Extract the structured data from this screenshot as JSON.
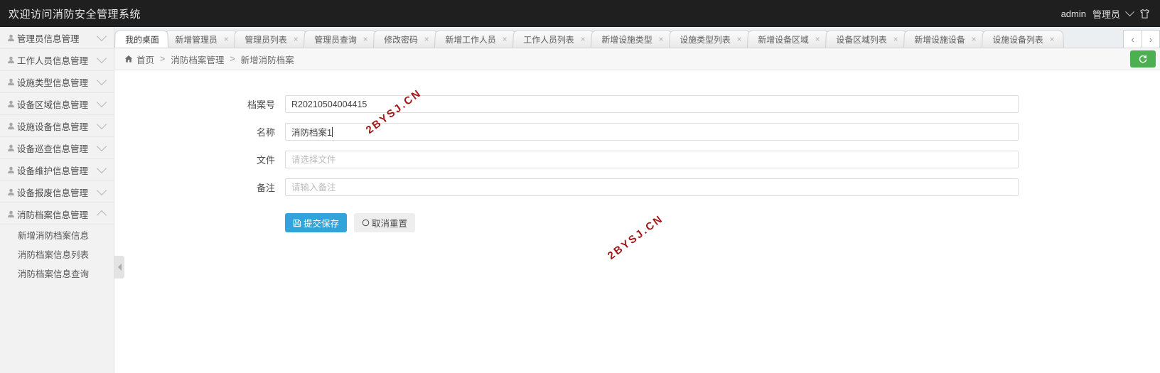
{
  "header": {
    "title": "欢迎访问消防安全管理系统",
    "user": "admin",
    "role": "管理员",
    "dropdown_icon": "chevron-down-icon",
    "theme_icon": "shirt-icon"
  },
  "sidebar": {
    "items": [
      {
        "label": "管理员信息管理",
        "icon": "user-icon",
        "expanded": false
      },
      {
        "label": "工作人员信息管理",
        "icon": "user-icon",
        "expanded": false
      },
      {
        "label": "设施类型信息管理",
        "icon": "user-icon",
        "expanded": false
      },
      {
        "label": "设备区域信息管理",
        "icon": "user-icon",
        "expanded": false
      },
      {
        "label": "设施设备信息管理",
        "icon": "user-icon",
        "expanded": false
      },
      {
        "label": "设备巡查信息管理",
        "icon": "user-icon",
        "expanded": false
      },
      {
        "label": "设备维护信息管理",
        "icon": "user-icon",
        "expanded": false
      },
      {
        "label": "设备报废信息管理",
        "icon": "user-icon",
        "expanded": false
      },
      {
        "label": "消防档案信息管理",
        "icon": "user-icon",
        "expanded": true
      }
    ],
    "submenu": [
      "新增消防档案信息",
      "消防档案信息列表",
      "消防档案信息查询"
    ],
    "collapse_handle_icon": "caret-left-icon"
  },
  "tabs": {
    "items": [
      {
        "label": "我的桌面",
        "closable": false,
        "active": true
      },
      {
        "label": "新增管理员",
        "closable": true,
        "active": false
      },
      {
        "label": "管理员列表",
        "closable": true,
        "active": false
      },
      {
        "label": "管理员查询",
        "closable": true,
        "active": false
      },
      {
        "label": "修改密码",
        "closable": true,
        "active": false
      },
      {
        "label": "新增工作人员",
        "closable": true,
        "active": false
      },
      {
        "label": "工作人员列表",
        "closable": true,
        "active": false
      },
      {
        "label": "新增设施类型",
        "closable": true,
        "active": false
      },
      {
        "label": "设施类型列表",
        "closable": true,
        "active": false
      },
      {
        "label": "新增设备区域",
        "closable": true,
        "active": false
      },
      {
        "label": "设备区域列表",
        "closable": true,
        "active": false
      },
      {
        "label": "新增设施设备",
        "closable": true,
        "active": false
      },
      {
        "label": "设施设备列表",
        "closable": true,
        "active": false
      }
    ],
    "close_glyph": "×",
    "prev_glyph": "‹",
    "next_glyph": "›"
  },
  "breadcrumb": {
    "home_icon": "home-icon",
    "home": "首页",
    "separator": ">",
    "level2": "消防档案管理",
    "level3": "新增消防档案",
    "refresh_icon": "refresh-icon",
    "refresh_color": "#4caf50"
  },
  "form": {
    "fields": [
      {
        "label": "档案号",
        "value": "R20210504004415",
        "placeholder": "",
        "focused": false
      },
      {
        "label": "名称",
        "value": "消防档案1",
        "placeholder": "",
        "focused": true
      },
      {
        "label": "文件",
        "value": "",
        "placeholder": "请选择文件",
        "focused": false
      },
      {
        "label": "备注",
        "value": "",
        "placeholder": "请输入备注",
        "focused": false
      }
    ],
    "submit_label": "提交保存",
    "submit_icon": "save-icon",
    "submit_color": "#33a3dc",
    "reset_label": "取消重置",
    "reset_icon": "circle-icon"
  },
  "watermark": {
    "text": "2BYSJ.CN",
    "color": "#a01818"
  }
}
